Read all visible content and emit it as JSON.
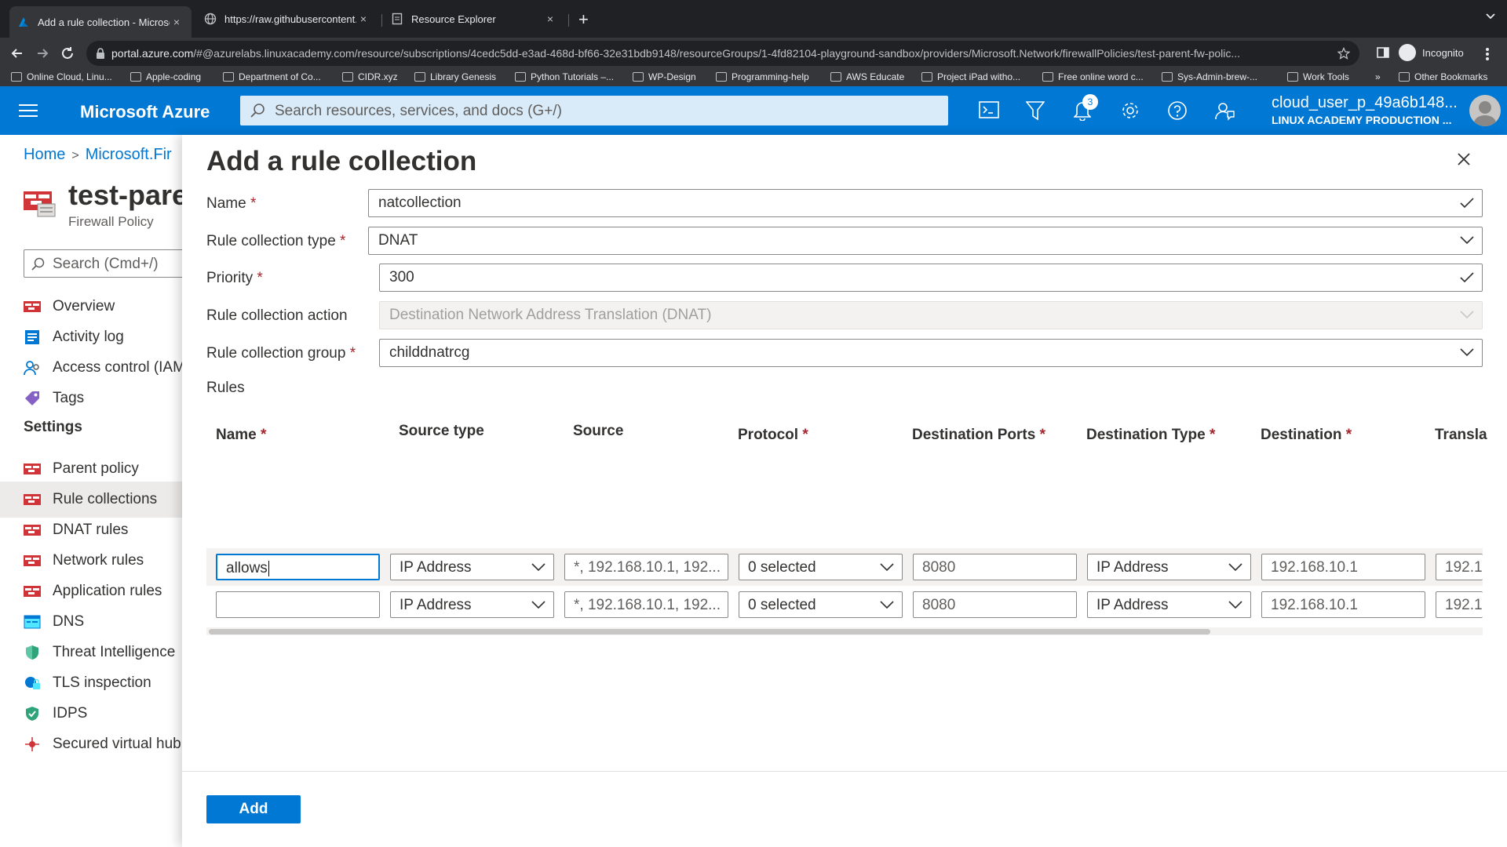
{
  "browser": {
    "tabs": [
      {
        "title": "Add a rule collection - Microso",
        "close": "×"
      },
      {
        "title": "https://raw.githubusercontent...",
        "close": "×"
      },
      {
        "title": "Resource Explorer",
        "close": "×"
      }
    ],
    "new_tab": "+",
    "url_host": "portal.azure.com",
    "url_rest": "/#@azurelabs.linuxacademy.com/resource/subscriptions/4cedc5dd-e3ad-468d-bf66-32e31bdb9148/resourceGroups/1-4fd82104-playground-sandbox/providers/Microsoft.Network/firewallPolicies/test-parent-fw-polic...",
    "incognito": "Incognito",
    "bookmarks": [
      "Online Cloud, Linu...",
      "Apple-coding",
      "Department of Co...",
      "CIDR.xyz",
      "Library Genesis",
      "Python Tutorials –...",
      "WP-Design",
      "Programming-help",
      "AWS Educate",
      "Project iPad witho...",
      "Free online word c...",
      "Sys-Admin-brew-...",
      "Work Tools"
    ],
    "bookmarks_more": "»",
    "other_bookmarks": "Other Bookmarks"
  },
  "azure": {
    "brand": "Microsoft Azure",
    "search_placeholder": "Search resources, services, and docs (G+/)",
    "notification_count": "3",
    "user_name": "cloud_user_p_49a6b148...",
    "user_org": "LINUX ACADEMY PRODUCTION ..."
  },
  "breadcrumb": {
    "home": "Home",
    "item": "Microsoft.Fir"
  },
  "resource": {
    "title": "test-pare",
    "type": "Firewall Policy"
  },
  "left_search": "Search (Cmd+/)",
  "menu": {
    "top": [
      "Overview",
      "Activity log",
      "Access control (IAM)",
      "Tags"
    ],
    "settings_heading": "Settings",
    "settings": [
      "Parent policy",
      "Rule collections",
      "DNAT rules",
      "Network rules",
      "Application rules",
      "DNS",
      "Threat Intelligence",
      "TLS inspection",
      "IDPS",
      "Secured virtual hub"
    ]
  },
  "panel": {
    "title": "Add a rule collection",
    "form": {
      "name_label": "Name",
      "name_value": "natcollection",
      "type_label": "Rule collection type",
      "type_value": "DNAT",
      "priority_label": "Priority",
      "priority_value": "300",
      "action_label": "Rule collection action",
      "action_value": "Destination Network Address Translation (DNAT)",
      "group_label": "Rule collection group",
      "group_value": "childdnatrcg",
      "required_mark": "*"
    },
    "rules_label": "Rules",
    "columns": {
      "name": "Name",
      "source_type": "Source type",
      "source": "Source",
      "protocol": "Protocol",
      "dest_ports": "Destination Ports",
      "dest_type": "Destination Type",
      "destination": "Destination",
      "translated": "Transla"
    },
    "rows": [
      {
        "name": "allows",
        "source_type": "IP Address",
        "source": "*, 192.168.10.1, 192...",
        "protocol": "0 selected",
        "dest_ports": "8080",
        "dest_type": "IP Address",
        "destination": "192.168.10.1",
        "translated": "192.1"
      },
      {
        "name": "",
        "source_type": "IP Address",
        "source": "*, 192.168.10.1, 192...",
        "protocol": "0 selected",
        "dest_ports": "8080",
        "dest_type": "IP Address",
        "destination": "192.168.10.1",
        "translated": "192.1"
      }
    ],
    "add_button": "Add"
  },
  "colors": {
    "azure_blue": "#0078d4",
    "required_red": "#a4262c",
    "chrome_dark": "#202124"
  }
}
